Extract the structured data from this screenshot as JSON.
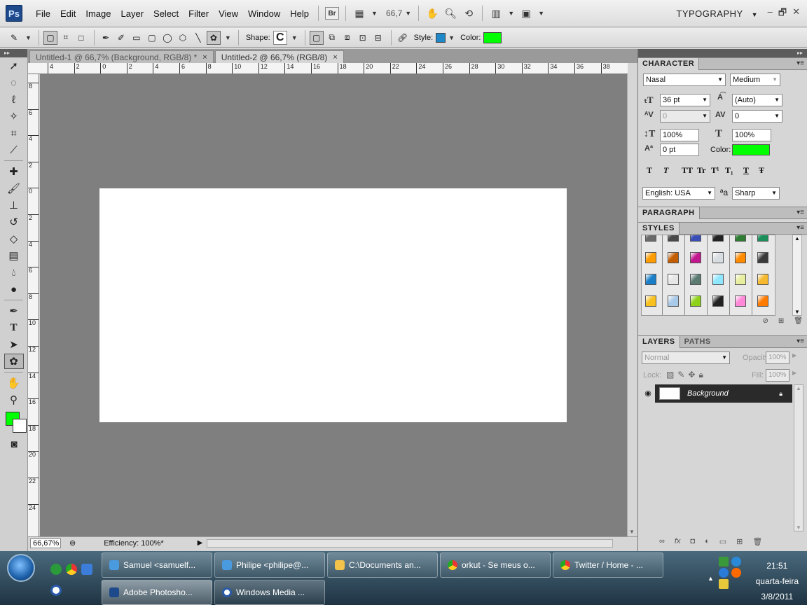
{
  "app": {
    "logo": "Ps",
    "workspace": "TYPOGRAPHY",
    "zoom": "66,7",
    "bridge": "Br"
  },
  "menu": [
    "File",
    "Edit",
    "Image",
    "Layer",
    "Select",
    "Filter",
    "View",
    "Window",
    "Help"
  ],
  "options": {
    "shape_label": "Shape:",
    "style_label": "Style:",
    "color_label": "Color:",
    "style_color": "#1e88c8",
    "color": "#00ff00"
  },
  "tabs": [
    {
      "label": "Untitled-1 @ 66,7% (Background, RGB/8) *",
      "close": "×"
    },
    {
      "label": "Untitled-2 @ 66,7% (RGB/8)",
      "close": "×"
    }
  ],
  "ruler_top": [
    "4",
    "2",
    "0",
    "2",
    "4",
    "6",
    "8",
    "10",
    "12",
    "14",
    "16",
    "18",
    "20",
    "22",
    "24",
    "26",
    "28",
    "30",
    "32",
    "34",
    "36",
    "38"
  ],
  "ruler_left": [
    "8",
    "6",
    "4",
    "2",
    "0",
    "2",
    "4",
    "6",
    "8",
    "10",
    "12",
    "14",
    "16",
    "18",
    "20",
    "22",
    "24"
  ],
  "status": {
    "zoom": "66,67%",
    "info": "Efficiency: 100%*"
  },
  "character": {
    "title": "CHARACTER",
    "font_family": "Nasal",
    "font_style": "Medium",
    "size": "36 pt",
    "leading": "(Auto)",
    "kerning": "0",
    "tracking": "0",
    "vscale": "100%",
    "hscale": "100%",
    "baseline": "0 pt",
    "color_label": "Color:",
    "color": "#00ff00",
    "language": "English: USA",
    "aa_label": "a",
    "antialias": "Sharp",
    "styles_row": [
      "T",
      "T",
      "TT",
      "Tr",
      "T¹",
      "T₁",
      "T",
      "Ŧ"
    ]
  },
  "paragraph": {
    "title": "PARAGRAPH"
  },
  "styles": {
    "title": "STYLES",
    "swatches": [
      "#6a6a6a",
      "#4a4a4a",
      "#3a4fb5",
      "#222222",
      "#2e7d32",
      "#1a8f5a",
      "#ff9c00",
      "#c45c00",
      "#c2188d",
      "#d8dde2",
      "#ff8a00",
      "#3a3a3a",
      "#1a7fc8",
      "#e6e6e6",
      "#5a7a72",
      "#8fe6ff",
      "#e8eea0",
      "#f5b82e",
      "#f8c11e",
      "#a9c9e8",
      "#8fd11a",
      "#222222",
      "#ff88d8",
      "#ff7a00"
    ]
  },
  "layers": {
    "tab1": "LAYERS",
    "tab2": "PATHS",
    "blend": "Normal",
    "opacity_label": "Opacity:",
    "opacity": "100%",
    "lock_label": "Lock:",
    "fill_label": "Fill:",
    "fill": "100%",
    "layer_name": "Background"
  },
  "taskbar": {
    "row1": [
      "Samuel <samuelf...",
      "Philipe <philipe@...",
      "C:\\Documents an...",
      "orkut - Se meus o...",
      "Twitter / Home - ..."
    ],
    "row2": [
      "Adobe Photosho...",
      "Windows Media ..."
    ],
    "time": "21:51",
    "day": "quarta-feira",
    "date": "3/8/2011"
  }
}
